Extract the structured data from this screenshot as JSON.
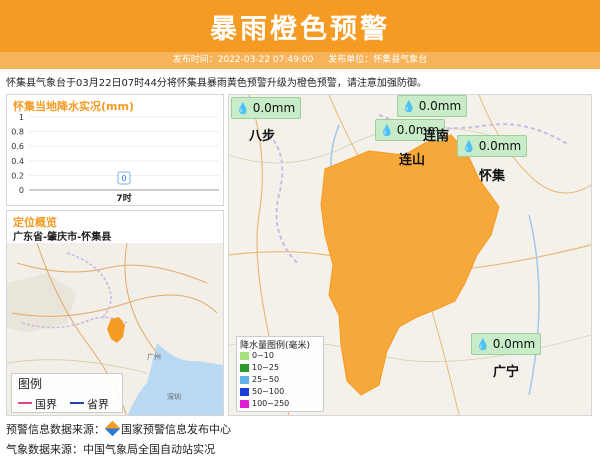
{
  "header": {
    "title": "暴雨橙色预警",
    "publish_time_label": "发布时间：2022-03-22 07:49:00",
    "publisher_label": "发布单位：怀集县气象台"
  },
  "summary": "怀集县气象台于03月22日07时44分将怀集县暴雨黄色预警升级为橙色预警，请注意加强防御。",
  "rainfall_panel": {
    "title": "怀集当地降水实况(mm)",
    "chart_data": {
      "type": "bar",
      "categories": [
        "7时"
      ],
      "values": [
        0
      ],
      "data_labels": [
        "0"
      ],
      "ylim": [
        0,
        1
      ],
      "yticks": [
        "1",
        "0.8",
        "0.6",
        "0.4",
        "0.2",
        "0"
      ],
      "title": "",
      "xlabel": "",
      "ylabel": ""
    }
  },
  "location_panel": {
    "title": "定位概览",
    "region": "广东省-肇庆市-怀集县",
    "legend_title": "图例",
    "legend_items": [
      {
        "label": "国界",
        "color": "#d94a7a"
      },
      {
        "label": "省界",
        "color": "#2244aa"
      }
    ]
  },
  "main_map": {
    "stations": [
      {
        "value": "0.0mm"
      },
      {
        "value": "0.0mm"
      },
      {
        "value": "0.0mm"
      },
      {
        "value": "0.0mm"
      },
      {
        "value": "0.0mm"
      }
    ],
    "towns": [
      "八步",
      "连山",
      "连南",
      "怀集",
      "广宁"
    ],
    "region_color": "#f7a83a"
  },
  "rain_legend": {
    "title": "降水量图例(毫米)",
    "items": [
      {
        "label": "0~10",
        "color": "#a6e07a"
      },
      {
        "label": "10~25",
        "color": "#2e9a2e"
      },
      {
        "label": "25~50",
        "color": "#5fb3e8"
      },
      {
        "label": "50~100",
        "color": "#1a3fd6"
      },
      {
        "label": "100~250",
        "color": "#e01ed4"
      }
    ]
  },
  "footer": {
    "warning_source_label": "预警信息数据来源：",
    "warning_source_name": "国家预警信息发布中心",
    "weather_source": "气象数据来源：中国气象局全国自动站实况"
  }
}
